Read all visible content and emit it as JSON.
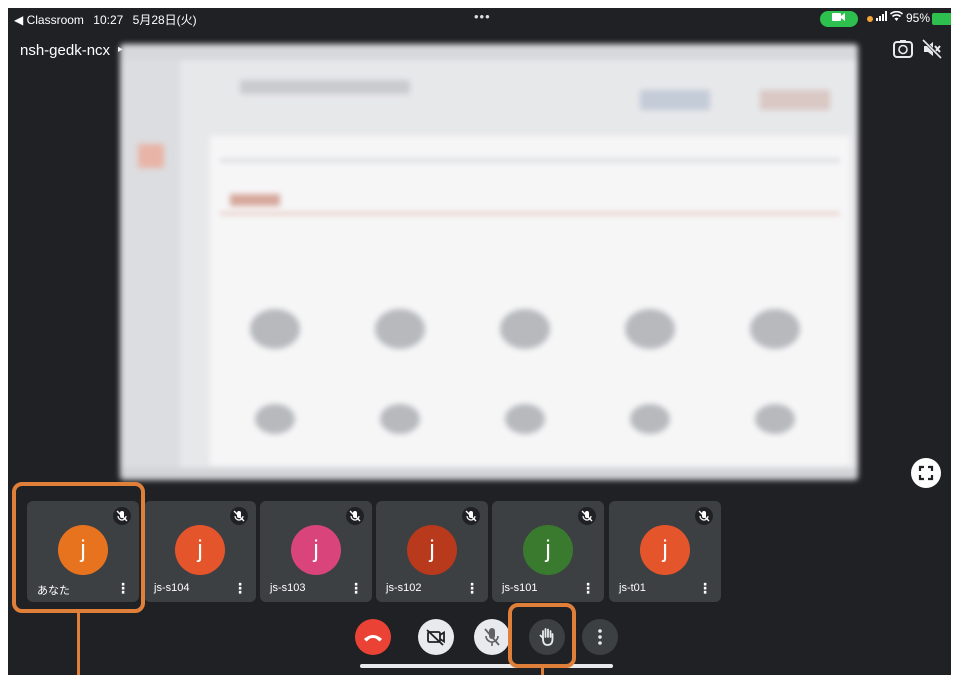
{
  "status_bar": {
    "app_back": "◀ Classroom",
    "time": "10:27",
    "date": "5月28日(火)",
    "dots": "•••",
    "battery": "95%"
  },
  "meeting": {
    "code": "nsh-gedk-ncx"
  },
  "participants": [
    {
      "initial": "j",
      "name": "あなた",
      "color": "#e8731f"
    },
    {
      "initial": "j",
      "name": "js-s104",
      "color": "#e5552b"
    },
    {
      "initial": "j",
      "name": "js-s103",
      "color": "#d9457a"
    },
    {
      "initial": "j",
      "name": "js-s102",
      "color": "#b8391c"
    },
    {
      "initial": "j",
      "name": "js-s101",
      "color": "#3a7a2e"
    },
    {
      "initial": "j",
      "name": "js-t01",
      "color": "#e5552b"
    }
  ],
  "colors": {
    "highlight": "#e07f3a",
    "end_call": "#ea4335",
    "background": "#202124",
    "tile": "#3c4043"
  },
  "controls": [
    "end-call",
    "camera-off",
    "mic-off",
    "raise-hand",
    "more-options"
  ]
}
